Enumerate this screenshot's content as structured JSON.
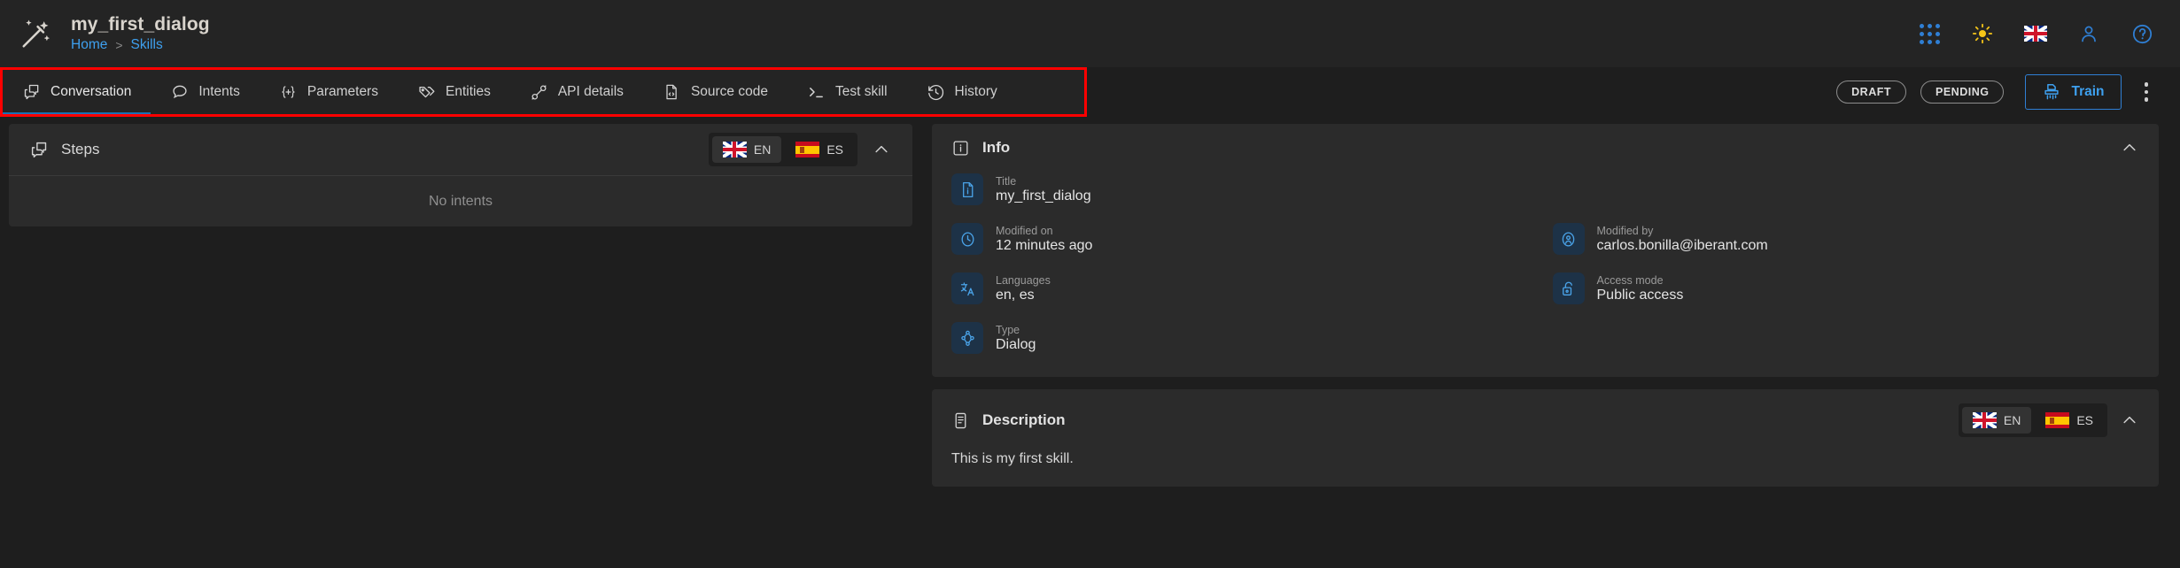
{
  "header": {
    "logo_icon": "magic-wand-icon",
    "title": "my_first_dialog",
    "breadcrumb": {
      "home": "Home",
      "separator": ">",
      "current": "Skills"
    },
    "right_icons": [
      "apps-grid-icon",
      "sun-theme-icon",
      "uk-flag-icon",
      "user-account-icon",
      "help-icon"
    ]
  },
  "tabs": [
    {
      "label": "Conversation",
      "icon": "conversation-icon",
      "active": true
    },
    {
      "label": "Intents",
      "icon": "chat-bubble-icon",
      "active": false
    },
    {
      "label": "Parameters",
      "icon": "curly-plus-icon",
      "active": false
    },
    {
      "label": "Entities",
      "icon": "tags-icon",
      "active": false
    },
    {
      "label": "API details",
      "icon": "plug-icon",
      "active": false
    },
    {
      "label": "Source code",
      "icon": "code-file-icon",
      "active": false
    },
    {
      "label": "Test skill",
      "icon": "terminal-prompt-icon",
      "active": false
    },
    {
      "label": "History",
      "icon": "history-clock-icon",
      "active": false
    }
  ],
  "toolbar": {
    "status_badge": "DRAFT",
    "pending_badge": "PENDING",
    "train_label": "Train",
    "train_icon": "train-shredder-icon",
    "more_icon": "kebab-menu-icon",
    "accent_color": "#2f7fd4",
    "highlight_color": "#ff0000"
  },
  "steps": {
    "title": "Steps",
    "icon": "conversation-icon",
    "empty_text": "No intents",
    "languages": [
      {
        "code": "EN",
        "flag": "uk-flag-icon",
        "selected": true
      },
      {
        "code": "ES",
        "flag": "spain-flag-icon",
        "selected": false
      }
    ],
    "collapse_icon": "chevron-up-icon"
  },
  "info": {
    "title": "Info",
    "icon": "info-box-icon",
    "collapse_icon": "chevron-up-icon",
    "fields": [
      {
        "label": "Title",
        "value": "my_first_dialog",
        "icon": "document-info-icon",
        "full_width": true
      },
      {
        "label": "Modified on",
        "value": "12 minutes ago",
        "icon": "clock-icon",
        "full_width": false
      },
      {
        "label": "Modified by",
        "value": "carlos.bonilla@iberant.com",
        "icon": "user-badge-icon",
        "full_width": false
      },
      {
        "label": "Languages",
        "value": "en, es",
        "icon": "translate-icon",
        "full_width": false
      },
      {
        "label": "Access mode",
        "value": "Public access",
        "icon": "unlock-icon",
        "full_width": false
      },
      {
        "label": "Type",
        "value": "Dialog",
        "icon": "node-tree-icon",
        "full_width": false
      }
    ]
  },
  "description": {
    "title": "Description",
    "icon": "description-list-icon",
    "text": "This is my first skill.",
    "collapse_icon": "chevron-up-icon",
    "languages": [
      {
        "code": "EN",
        "flag": "uk-flag-icon",
        "selected": true
      },
      {
        "code": "ES",
        "flag": "spain-flag-icon",
        "selected": false
      }
    ]
  }
}
